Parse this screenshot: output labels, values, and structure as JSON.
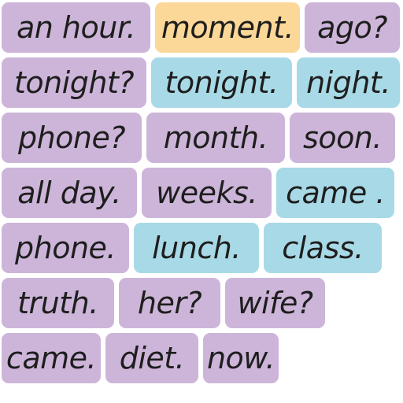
{
  "colors": {
    "purple": "#cdb5d9",
    "blue": "#a8d9e6",
    "orange": "#fcd898",
    "text": "#1e1e1e"
  },
  "tiles": [
    {
      "label": "an hour.",
      "color": "purple"
    },
    {
      "label": "moment.",
      "color": "orange",
      "state": "selected"
    },
    {
      "label": "ago?",
      "color": "purple"
    },
    {
      "label": "tonight?",
      "color": "purple"
    },
    {
      "label": "tonight.",
      "color": "blue"
    },
    {
      "label": "night.",
      "color": "blue"
    },
    {
      "label": "phone?",
      "color": "purple"
    },
    {
      "label": "month.",
      "color": "purple"
    },
    {
      "label": "soon.",
      "color": "purple"
    },
    {
      "label": "all day.",
      "color": "purple"
    },
    {
      "label": "weeks.",
      "color": "purple"
    },
    {
      "label": "came .",
      "color": "blue"
    },
    {
      "label": "phone.",
      "color": "purple"
    },
    {
      "label": "lunch.",
      "color": "blue"
    },
    {
      "label": "class.",
      "color": "blue"
    },
    {
      "label": "truth.",
      "color": "purple"
    },
    {
      "label": "her?",
      "color": "purple"
    },
    {
      "label": "wife?",
      "color": "purple"
    },
    {
      "label": "came.",
      "color": "purple"
    },
    {
      "label": "diet.",
      "color": "purple"
    },
    {
      "label": "now.",
      "color": "purple"
    }
  ]
}
